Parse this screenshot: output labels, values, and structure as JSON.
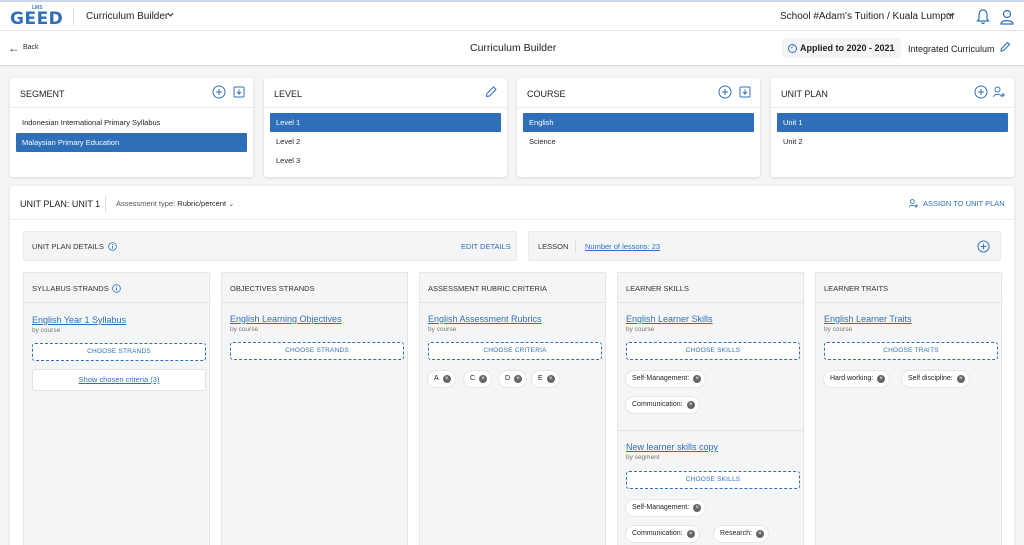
{
  "topbar": {
    "logo_small": "LMS",
    "logo_text": "GEED",
    "app_name": "Curriculum Builder",
    "school": "School #Adam's Tuition / Kuala Lumpur"
  },
  "subbar": {
    "back_label": "Back",
    "title": "Curriculum Builder",
    "applied": "Applied to 2020 - 2021",
    "integrated": "Integrated Curriculum"
  },
  "segment": {
    "title": "SEGMENT",
    "items": [
      "Indonesian International Primary Syllabus",
      "Malaysian Primary Education"
    ]
  },
  "level": {
    "title": "LEVEL",
    "items": [
      "Level 1",
      "Level 2",
      "Level 3"
    ]
  },
  "course": {
    "title": "COURSE",
    "items": [
      "English",
      "Science"
    ]
  },
  "unit_plan": {
    "title": "UNIT PLAN",
    "items": [
      "Unit 1",
      "Unit 2"
    ]
  },
  "main": {
    "title": "UNIT PLAN: UNIT 1",
    "assessment_label": "Assessment type:",
    "assessment_value": "Rubric/percent",
    "assign": "ASSIGN TO UNIT PLAN",
    "details_label": "UNIT PLAN DETAILS",
    "edit_details": "EDIT DETAILS",
    "lesson_label": "LESSON",
    "lesson_count": "Number of lessons: 23"
  },
  "columns": {
    "syllabus": {
      "title": "SYLLABUS STRANDS",
      "link": "English Year 1 Syllabus",
      "sub": "by course",
      "choose": "CHOOSE STRANDS",
      "show": "Show chosen criteria (3)"
    },
    "objectives": {
      "title": "OBJECTIVES STRANDS",
      "link": "English Learning Objectives",
      "sub": "by course",
      "choose": "CHOOSE STRANDS"
    },
    "rubric": {
      "title": "ASSESSMENT RUBRIC CRITERIA",
      "link": "English Assessment Rubrics",
      "sub": "by course",
      "choose": "CHOOSE CRITERIA",
      "chips": [
        "A",
        "C",
        "D",
        "E"
      ]
    },
    "skills": {
      "title": "LEARNER SKILLS",
      "link": "English Learner Skills",
      "sub": "by course",
      "choose": "CHOOSE SKILLS",
      "chips": [
        "Self-Management:",
        "Communication:"
      ],
      "link2": "New learner skills copy",
      "sub2": "by segment",
      "choose2": "CHOOSE SKILLS",
      "chips2": [
        "Self-Management:",
        "Communication:",
        "Research:"
      ]
    },
    "traits": {
      "title": "LEARNER TRAITS",
      "link": "English Learner Traits",
      "sub": "by course",
      "choose": "CHOOSE TRAITS",
      "chips": [
        "Hard working:",
        "Self discipline:"
      ]
    }
  },
  "colors": {
    "accent": "#2f6fba",
    "background": "#f4f5f7"
  }
}
